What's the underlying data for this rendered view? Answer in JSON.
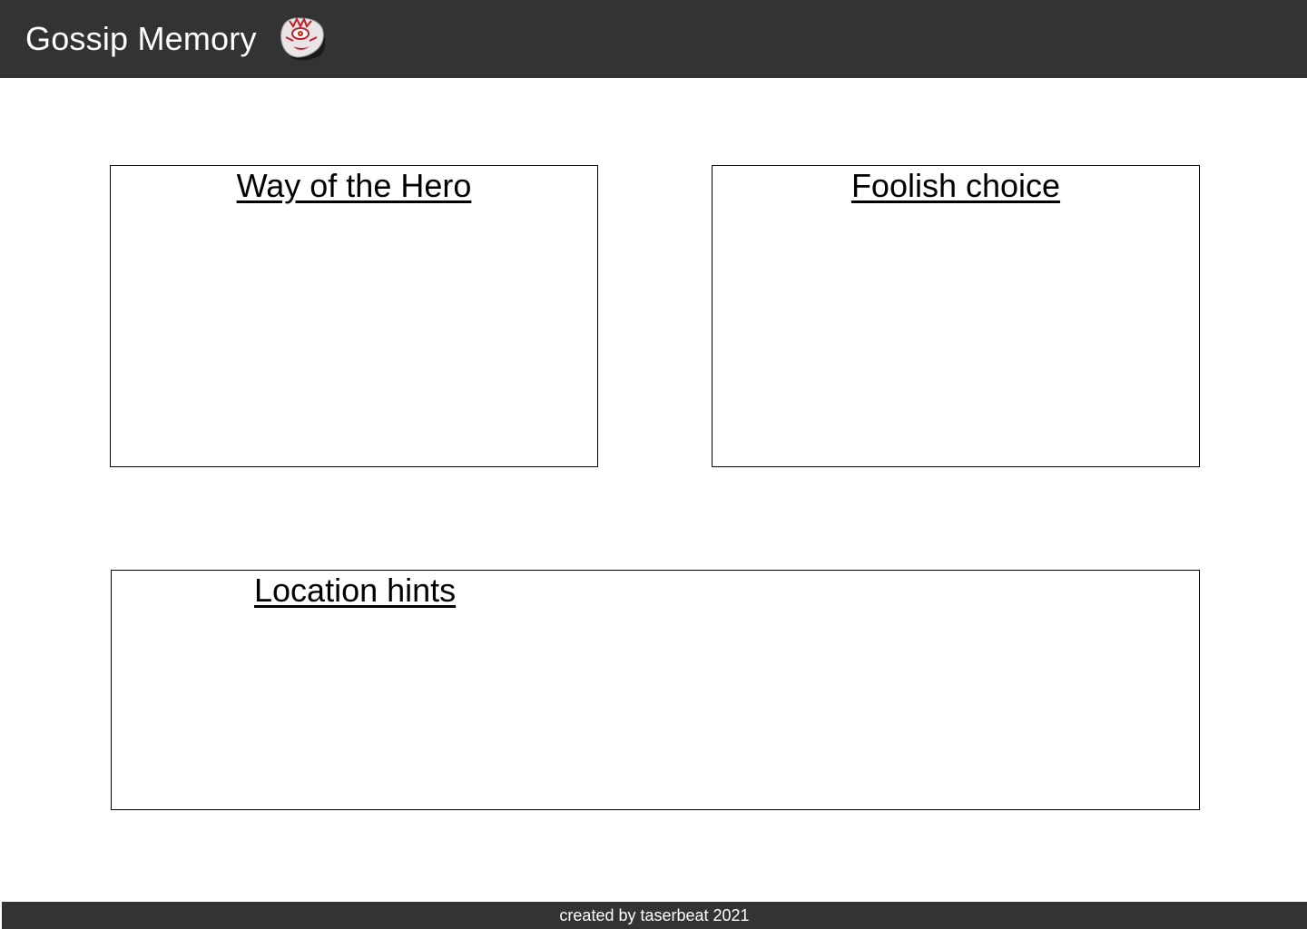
{
  "header": {
    "title": "Gossip Memory",
    "logo_icon": "gossip-stone-mask-icon",
    "background": "#333333",
    "title_color": "#ffffff"
  },
  "panels": [
    {
      "title": "Way of the Hero"
    },
    {
      "title": "Foolish choice"
    },
    {
      "title": "Location hints"
    }
  ],
  "footer": {
    "text": "created by taserbeat 2021",
    "background": "#333333"
  }
}
